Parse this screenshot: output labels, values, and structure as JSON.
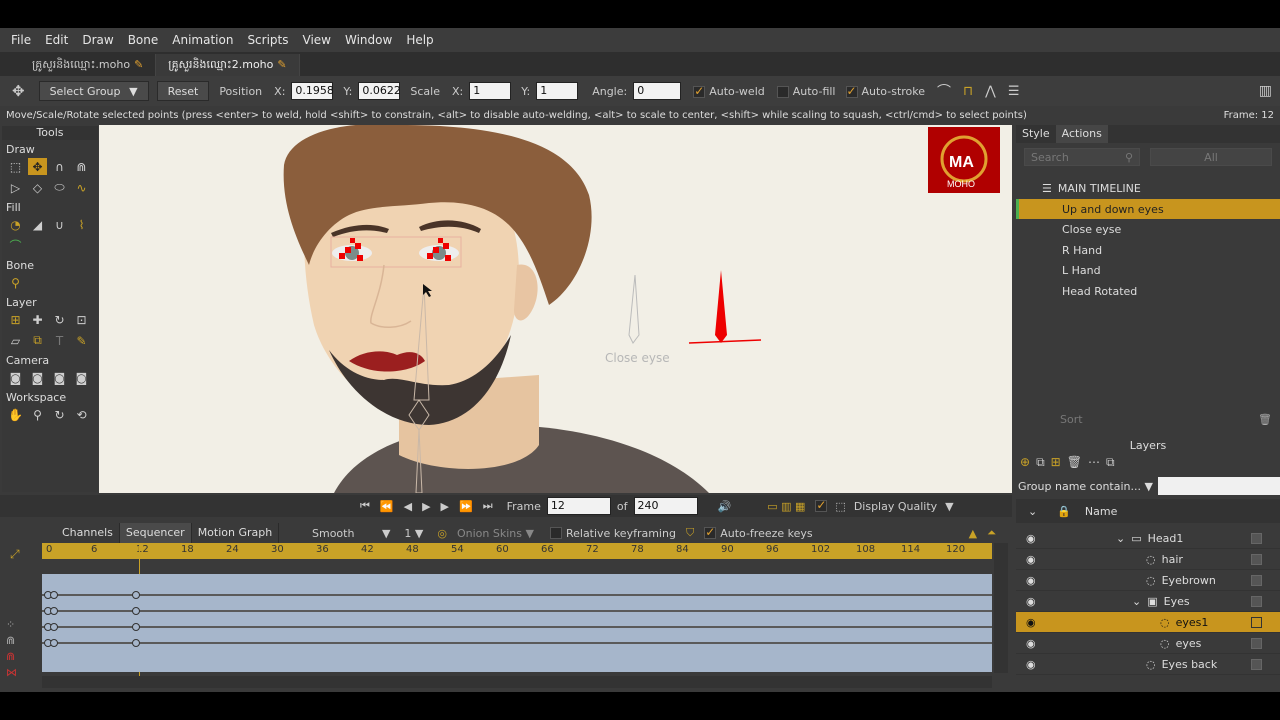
{
  "menu": [
    "File",
    "Edit",
    "Draw",
    "Bone",
    "Animation",
    "Scripts",
    "View",
    "Window",
    "Help"
  ],
  "tabs": [
    "គ្រូសួរនិងឈ្មោះ.moho",
    "គ្រូសួរនិងឈ្មោះ2.moho"
  ],
  "options": {
    "select_group": "Select Group",
    "reset": "Reset",
    "position": "Position",
    "x_label": "X:",
    "x_val": "0.1958",
    "y_label": "Y:",
    "y_val": "0.0622",
    "scale": "Scale",
    "sx_label": "X:",
    "sx_val": "1",
    "sy_label": "Y:",
    "sy_val": "1",
    "angle": "Angle:",
    "angle_val": "0",
    "auto_weld": "Auto-weld",
    "auto_fill": "Auto-fill",
    "auto_stroke": "Auto-stroke"
  },
  "status": "Move/Scale/Rotate selected points (press <enter> to weld, hold <shift> to constrain, <alt> to disable auto-welding, <alt> to scale to center, <shift> while scaling to squash, <ctrl/cmd> to select points)",
  "frame_status": "Frame: 12",
  "tools": {
    "title": "Tools",
    "sections": [
      "Draw",
      "Fill",
      "Bone",
      "Layer",
      "Camera",
      "Workspace"
    ]
  },
  "canvas": {
    "pose_label": "Close eyse",
    "logo_text": "MOHO"
  },
  "right": {
    "tabs": [
      "Style",
      "Actions"
    ],
    "search": "Search",
    "all": "All",
    "main_timeline": "MAIN TIMELINE",
    "actions": [
      "Up and down eyes",
      "Close eyse",
      "R Hand",
      "L Hand",
      "Head Rotated"
    ],
    "sort": "Sort",
    "layers_title": "Layers",
    "group_filter": "Group name contain...",
    "name_col": "Name",
    "layers": [
      {
        "name": "Head1",
        "indent": 1
      },
      {
        "name": "hair",
        "indent": 2
      },
      {
        "name": "Eyebrown",
        "indent": 2
      },
      {
        "name": "Eyes",
        "indent": 2
      },
      {
        "name": "eyes1",
        "indent": 3
      },
      {
        "name": "eyes",
        "indent": 3
      },
      {
        "name": "Eyes back",
        "indent": 2
      }
    ]
  },
  "playbar": {
    "frame_label": "Frame",
    "frame_val": "12",
    "of_label": "of",
    "total": "240",
    "display_quality": "Display Quality"
  },
  "timeline": {
    "tabs": [
      "Channels",
      "Sequencer",
      "Motion Graph"
    ],
    "interp": "Smooth",
    "interp_num": "1",
    "onion": "Onion Skins",
    "relative": "Relative keyframing",
    "autofreeze": "Auto-freeze keys",
    "ruler": [
      "0",
      "6",
      "12",
      "18",
      "24",
      "30",
      "36",
      "42",
      "48",
      "54",
      "60",
      "66",
      "72",
      "78",
      "84",
      "90",
      "96",
      "102",
      "108",
      "114",
      "120"
    ]
  }
}
